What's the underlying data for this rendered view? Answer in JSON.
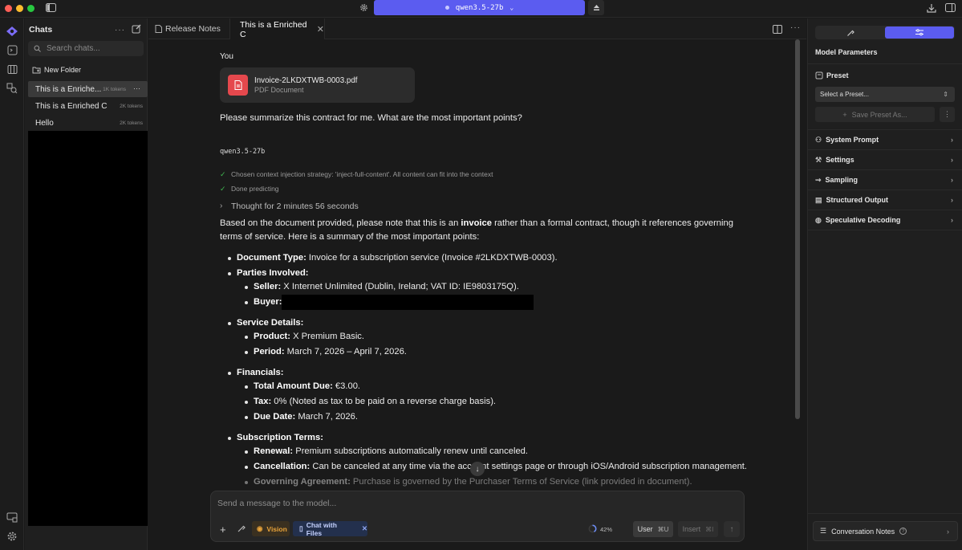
{
  "colors": {
    "accent": "#5b5cf0",
    "bg": "#1a1a1a",
    "panel": "#1f1f1f",
    "pdf_red": "#e5484d",
    "check_green": "#3fb950",
    "vision_orange": "#e8a33a",
    "chat_files_blue": "#6c8cf5"
  },
  "titlebar": {
    "model_name": "qwen3.5-27b"
  },
  "chat_panel": {
    "title": "Chats",
    "search_placeholder": "Search chats...",
    "new_folder": "New Folder",
    "items": [
      {
        "label": "This is a Enriche...",
        "tokens": "1K tokens"
      },
      {
        "label": "This is a Enriched C",
        "tokens": "2K tokens"
      },
      {
        "label": "Hello",
        "tokens": "2K tokens"
      }
    ]
  },
  "tabs": [
    {
      "label": "Release Notes"
    },
    {
      "label": "This is a Enriched C"
    }
  ],
  "conversation": {
    "user_label": "You",
    "attachment": {
      "name": "Invoice-2LKDXTWB-0003.pdf",
      "type": "PDF Document"
    },
    "user_message": "Please summarize this contract for me. What are the most important points?",
    "model_label": "qwen3.5-27b",
    "status_lines": [
      "Chosen context injection strategy: 'inject-full-content'. All content can fit into the context",
      "Done predicting"
    ],
    "thought": "Thought for 2 minutes 56 seconds",
    "intro_part1": "Based on the document provided, please note that this is an ",
    "intro_bold": "invoice",
    "intro_part2": " rather than a formal contract, though it references governing",
    "intro_line2": "terms of service. Here is a summary of the most important points:",
    "doc_type_label": "Document Type:",
    "doc_type_value": " Invoice for a subscription service (Invoice #2LKDXTWB-0003).",
    "parties_label": "Parties Involved:",
    "seller_label": "Seller:",
    "seller_value": " X Internet Unlimited (Dublin, Ireland; VAT ID: IE9803175Q).",
    "buyer_label": "Buyer:",
    "service_label": "Service Details:",
    "product_label": "Product:",
    "product_value": " X Premium Basic.",
    "period_label": "Period:",
    "period_value": " March 7, 2026 – April 7, 2026.",
    "financials_label": "Financials:",
    "total_label": "Total Amount Due:",
    "total_value": " €3.00.",
    "tax_label": "Tax:",
    "tax_value": " 0% (Noted as tax to be paid on a reverse charge basis).",
    "due_label": "Due Date:",
    "due_value": " March 7, 2026.",
    "subscription_label": "Subscription Terms:",
    "renewal_label": "Renewal:",
    "renewal_value": " Premium subscriptions automatically renew until canceled.",
    "cancel_label": "Cancellation:",
    "cancel_value": " Can be canceled at any time via the account settings page or through iOS/Android subscription management.",
    "gov_label": "Governing Agreement:",
    "gov_value": " Purchase is governed by the Purchaser Terms of Service (link provided in document)."
  },
  "composer": {
    "placeholder": "Send a message to the model...",
    "vision": "Vision",
    "chat_with_files": "Chat with Files",
    "context_percent": "42%",
    "user_btn": "User",
    "user_shortcut": "⌘U",
    "insert_btn": "Insert",
    "insert_shortcut": "⌘I"
  },
  "right_panel": {
    "title": "Model Parameters",
    "preset_label": "Preset",
    "preset_select": "Select a Preset...",
    "save_preset": "Save Preset As...",
    "sections": [
      "System Prompt",
      "Settings",
      "Sampling",
      "Structured Output",
      "Speculative Decoding"
    ],
    "conversation_notes": "Conversation Notes"
  }
}
